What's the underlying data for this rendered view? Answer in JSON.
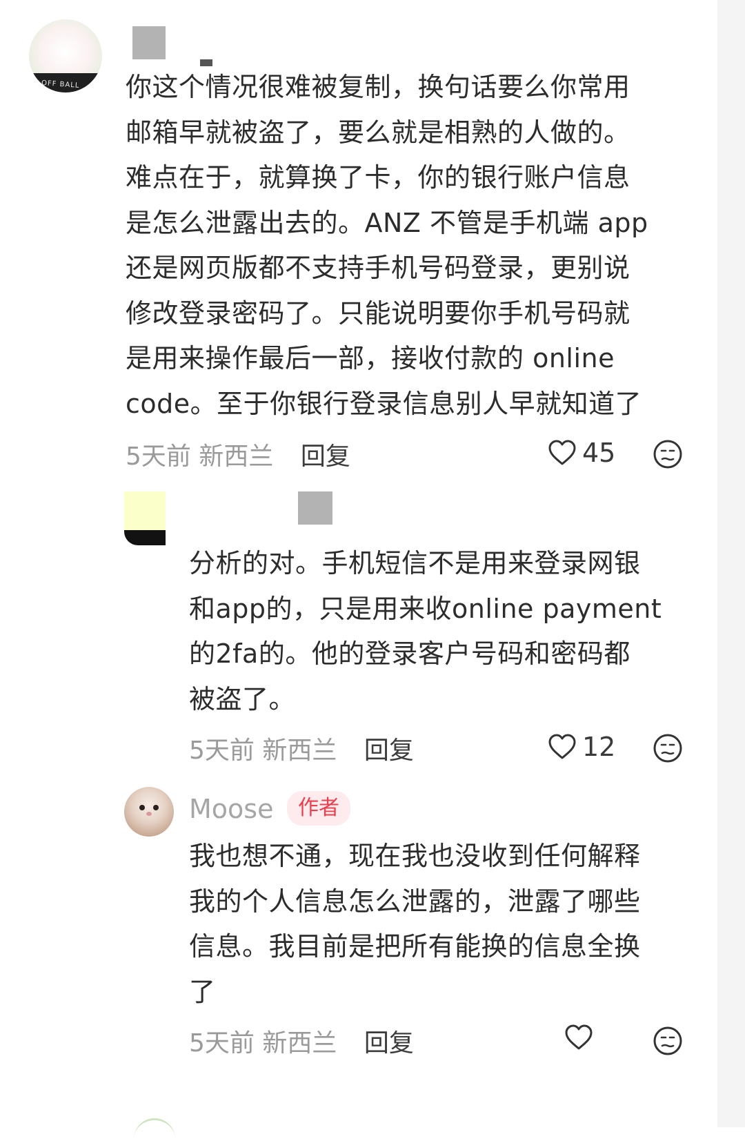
{
  "comments": [
    {
      "text": "你这个情况很难被复制，换句话要么你常用\n邮箱早就被盗了，要么就是相熟的人做的。\n难点在于，就算换了卡，你的银行账户信息\n是怎么泄露出去的。ANZ 不管是手机端 app\n还是网页版都不支持手机号码登录，更别说\n修改登录密码了。只能说明要你手机号码就\n是用来操作最后一部，接收付款的 online\ncode。至于你银行登录信息别人早就知道了",
      "time": "5天前",
      "location": "新西兰",
      "reply_label": "回复",
      "likes": "45"
    },
    {
      "text": "分析的对。手机短信不是用来登录网银\n和app的，只是用来收online payment\n的2fa的。他的登录客户号码和密码都\n被盗了。",
      "time": "5天前",
      "location": "新西兰",
      "reply_label": "回复",
      "likes": "12"
    },
    {
      "author": "Moose",
      "author_badge": "作者",
      "text": "我也想不通，现在我也没收到任何解释\n我的个人信息怎么泄露的，泄露了哪些\n信息。我目前是把所有能换的信息全换\n了",
      "time": "5天前",
      "location": "新西兰",
      "reply_label": "回复",
      "likes": ""
    }
  ],
  "avatar1_text": "OFF BALL",
  "icons": {
    "like": "heart-outline-icon",
    "dislike": "unamused-face-icon"
  },
  "colors": {
    "text": "#2c2c2c",
    "meta": "#9a9a9a",
    "badge_bg": "#fdebee",
    "badge_text": "#e8404e"
  }
}
